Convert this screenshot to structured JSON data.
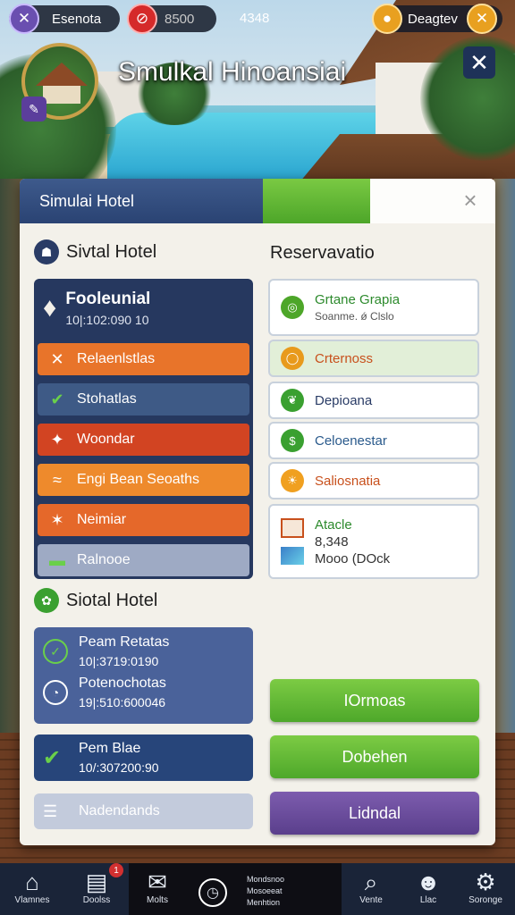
{
  "topbar": {
    "player_name": "Esenota",
    "coins": "8500",
    "center_value": "4348",
    "right_label": "Deagtev"
  },
  "header": {
    "title": "Smulkal Hinoansiai"
  },
  "panel": {
    "title": "Simulai Hotel",
    "left_section_title": "Sivtal Hotel",
    "right_section_title": "Reservavatio",
    "bottom_section_title": "Siotal Hotel"
  },
  "left_list": {
    "header_title": "Fooleunial",
    "header_sub": "10|:102:090 10",
    "rows": [
      {
        "label": "Relaenlstlas",
        "icon": "close-icon",
        "color": "#e8742a"
      },
      {
        "label": "Stohatlas",
        "icon": "check-icon",
        "color": "#3e5a86"
      },
      {
        "label": "Woondar",
        "icon": "flame-icon",
        "color": "#d24422"
      },
      {
        "label": "Engi Bean Seoaths",
        "icon": "feather-icon",
        "color": "#ee8a2c"
      },
      {
        "label": "Neimiar",
        "icon": "sparkle-icon",
        "color": "#e5682a"
      },
      {
        "label": "Ralnooe",
        "icon": "minus-icon",
        "color": "#9eaac4"
      }
    ]
  },
  "right_list": [
    {
      "title": "Grtane Grapia",
      "sub": "Soanme. ǿ Clslo",
      "icon": "target-icon"
    },
    {
      "title": "Crternoss",
      "icon": "circle-icon"
    },
    {
      "title": "Depioana",
      "icon": "leaf-icon"
    },
    {
      "title": "Celoenestar",
      "icon": "cash-icon"
    },
    {
      "title": "Saliosnatia",
      "icon": "sun-icon"
    }
  ],
  "right_info": {
    "line1": "Atacle",
    "line2": "8,348",
    "line3": "Mooo (DOck"
  },
  "bookings": [
    {
      "line1": "Peam Retatas",
      "line2": "10|:3719:0190",
      "icon": "check-icon"
    },
    {
      "line1": "Potenochotas",
      "line2": "19|:510:600046",
      "icon": "clock-icon"
    },
    {
      "line1": "Pem Blae",
      "line2": "10/:307200:90",
      "icon": "check-icon"
    },
    {
      "line1": "Nadendands",
      "icon": "list-icon"
    }
  ],
  "buttons": {
    "btn1": "IOrmoas",
    "btn2": "Dobehen",
    "btn3": "Lidndal"
  },
  "bottom_nav": [
    {
      "label": "Vlamnes",
      "icon": "home-icon"
    },
    {
      "label": "Doolss",
      "icon": "document-icon",
      "badge": "1"
    },
    {
      "label": "Molts",
      "icon": "mail-icon"
    },
    {
      "label": "",
      "icon": "clock-icon"
    },
    {
      "label": "Vente",
      "icon": "search-icon"
    },
    {
      "label": "Llac",
      "icon": "people-icon"
    },
    {
      "label": "Soronge",
      "icon": "gear-icon"
    }
  ],
  "bottom_nav_mid": {
    "line1": "Mondsnoo",
    "line2": "Mosoeeat",
    "line3": "Menhtion"
  }
}
